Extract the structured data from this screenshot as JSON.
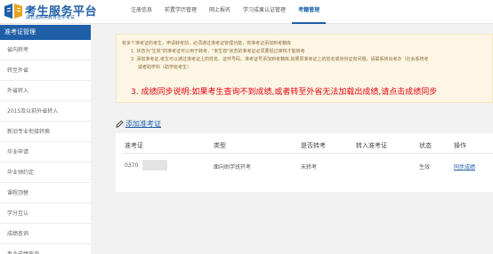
{
  "header": {
    "brand_title": "考生服务平台",
    "brand_subtitle": "湖北省高等教育自学考试",
    "nav": [
      "注册信息",
      "前置学历管理",
      "网上报名",
      "学习成果认证管理",
      "考籍管理"
    ],
    "active_nav": "考籍管理"
  },
  "sidebar": {
    "heading": "准考证管理",
    "items": [
      "省内转考",
      "转至外省",
      "外省转入",
      "2015及以前外省转入",
      "新旧专业衔接转换",
      "毕业申请",
      "毕业预约定",
      "课程顶替",
      "学分互认",
      "成绩查询",
      "专业成绩查询"
    ]
  },
  "notice": {
    "intro": "有多个准考证的考生，申请转考前，必须通过准考证管理功能，将准考证添加到考籍库",
    "line1": "1. 状态为\"生效\"的准考证可以用于转考，\"未生效\"状态的准考证必须要经过审核才能转考",
    "line2": "2. 添加准考证,考生可以通过准考证上的姓名、证件号码、准考证号添加到考籍库,如果原准考证上的姓名或身份证有问题，请联系转出考办（社会系统考",
    "line2b": "或者助学科（助学班考生）",
    "line3": "3. 成绩同步说明:如果考生查询不到成绩,或者转至外省无法加载出成绩,请点击成绩同步"
  },
  "add_link": "添加准考证",
  "table": {
    "headers": [
      "准考证",
      "类型",
      "是否转考",
      "转入准考证",
      "状态",
      "操作"
    ],
    "rows": [
      {
        "ticket": "0370",
        "type": "面向助学班开考",
        "transferred": "未转考",
        "transfer_ticket": "",
        "status": "生效",
        "action": "同步成绩"
      }
    ]
  },
  "colors": {
    "brand": "#1f5fa8",
    "alert": "#e60012",
    "notice_bg": "#fdf6e4"
  }
}
